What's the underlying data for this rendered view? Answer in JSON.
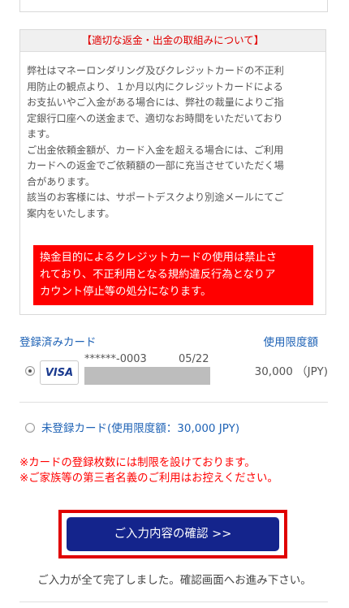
{
  "notice": {
    "title": "【適切な返金・出金の取組みについて】",
    "paragraph_lines": [
      "弊社はマネーロンダリング及びクレジットカードの不正利",
      "用防止の観点より、１か月以内にクレジットカードによる",
      "お支払いやご入金がある場合には、弊社の裁量によりご指",
      "定銀行口座への送金まで、適切なお時間をいただいており",
      "ます。",
      "ご出金依頼金額が、カード入金を超える場合には、ご利用",
      "カードへの返金でご依頼額の一部に充当させていただく場",
      "合があります。",
      "該当のお客様には、サポートデスクより別途メールにてご",
      "案内をいたします。"
    ],
    "warning_lines": [
      "換金目的によるクレジットカードの使用は禁止さ",
      "れており、不正利用となる規約違反行為となりア",
      "カウント停止等の処分になります。"
    ]
  },
  "cards": {
    "header_left": "登録済みカード",
    "header_right": "使用限度額",
    "items": [
      {
        "brand": "VISA",
        "number": "******-0003",
        "expiry": "05/22",
        "limit": "30,000 （JPY)",
        "selected": true
      }
    ],
    "unregistered_label": "未登録カード(使用限度額：30,000 JPY)"
  },
  "notes": [
    "※カードの登録枚数には制限を設けております。",
    "※ご家族等の第三者名義のご利用はお控えください。"
  ],
  "confirm_button": "ご入力内容の確認 >>",
  "completion_message": "ご入力が全て完了しました。確認画面へお進み下さい。",
  "colors": {
    "accent_blue": "#1f63b6",
    "button_navy": "#14248c",
    "warning_red": "#ff0000"
  }
}
